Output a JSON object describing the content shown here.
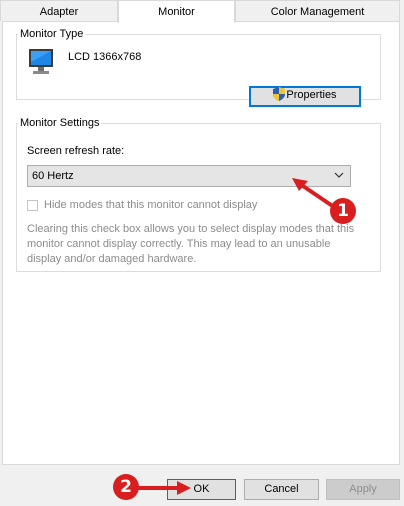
{
  "tabs": [
    {
      "label": "Adapter"
    },
    {
      "label": "Monitor"
    },
    {
      "label": "Color Management"
    }
  ],
  "monitor_type": {
    "group_label": "Monitor Type",
    "monitor_name": "LCD 1366x768",
    "properties_label": "Properties"
  },
  "monitor_settings": {
    "group_label": "Monitor Settings",
    "refresh_label": "Screen refresh rate:",
    "refresh_value": "60 Hertz",
    "hide_modes_label": "Hide modes that this monitor cannot display",
    "hide_modes_checked": false,
    "description": "Clearing this check box allows you to select display modes that this monitor cannot display correctly. This may lead to an unusable display and/or damaged hardware."
  },
  "footer": {
    "ok_label": "OK",
    "cancel_label": "Cancel",
    "apply_label": "Apply"
  },
  "annotations": {
    "marker_1": "1",
    "marker_2": "2"
  },
  "colors": {
    "accent": "#0078d7",
    "annotation": "#d81e1e"
  }
}
